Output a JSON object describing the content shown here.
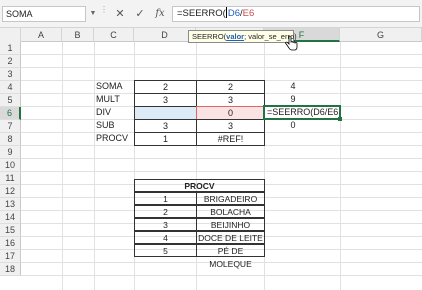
{
  "formula_bar": {
    "name_box": "SOMA",
    "formula_prefix": "=SEERRO(",
    "formula_ref1": "D6",
    "formula_sep": "/",
    "formula_ref2": "E6",
    "cancel_symbol": "✕",
    "enter_symbol": "✓",
    "fx_label": "fx"
  },
  "tooltip": {
    "func": "SEERRO(",
    "arg1": "valor",
    "rest": "; valor_se_erro)"
  },
  "columns": [
    "A",
    "B",
    "C",
    "D",
    "E",
    "F",
    "G"
  ],
  "rows": [
    "1",
    "2",
    "3",
    "4",
    "5",
    "6",
    "7",
    "8",
    "9",
    "10",
    "11",
    "12",
    "13",
    "14",
    "15",
    "16",
    "17",
    "18"
  ],
  "active": {
    "column": "F",
    "row": "6"
  },
  "ops_table": {
    "labels": [
      "SOMA",
      "MULT",
      "DIV",
      "SUB",
      "PROCV"
    ],
    "col_d": [
      "2",
      "3",
      "",
      "3",
      "1"
    ],
    "col_e": [
      "2",
      "3",
      "0",
      "3",
      "#REF!"
    ],
    "col_f": [
      "4",
      "9",
      "=SEERRO(D6/E6",
      "0",
      ""
    ]
  },
  "procv_table": {
    "header": "PROCV",
    "rows": [
      {
        "num": "1",
        "name": "BRIGADEIRO"
      },
      {
        "num": "2",
        "name": "BOLACHA"
      },
      {
        "num": "3",
        "name": "BEIJINHO"
      },
      {
        "num": "4",
        "name": "DOCE DE LEITE"
      },
      {
        "num": "5",
        "name": "PÉ DE MOLEQUE"
      }
    ]
  },
  "colors": {
    "accent": "#217346",
    "ref_blue": "#1f5fbf",
    "ref_red": "#d66666"
  },
  "icons": [
    "cancel-icon",
    "enter-icon",
    "fx-icon",
    "pointer-hand-icon",
    "dropdown-arrow-icon"
  ]
}
